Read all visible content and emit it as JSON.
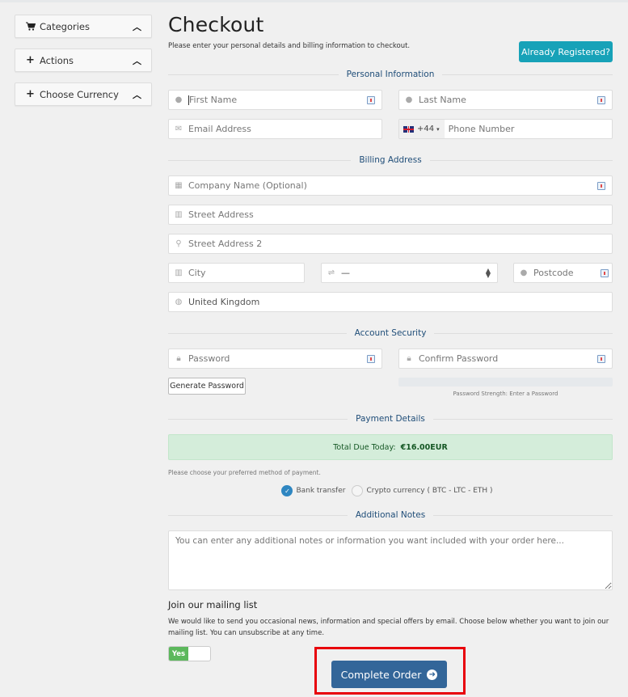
{
  "sidebar": {
    "panels": [
      {
        "label": "Categories",
        "icon": "shopping-cart-icon"
      },
      {
        "label": "Actions",
        "icon": "plus-icon"
      },
      {
        "label": "Choose Currency",
        "icon": "plus-icon"
      }
    ]
  },
  "header": {
    "title": "Checkout",
    "subtitle": "Please enter your personal details and billing information to checkout.",
    "already_registered": "Already Registered?"
  },
  "sections": {
    "personal": "Personal Information",
    "billing": "Billing Address",
    "security": "Account Security",
    "payment": "Payment Details",
    "notes": "Additional Notes"
  },
  "fields": {
    "first_name": "First Name",
    "last_name": "Last Name",
    "email": "Email Address",
    "phone_code": "+44",
    "phone": "Phone Number",
    "company": "Company Name (Optional)",
    "street": "Street Address",
    "street2": "Street Address 2",
    "city": "City",
    "state": "—",
    "postcode": "Postcode",
    "country": "United Kingdom",
    "password": "Password",
    "confirm_password": "Confirm Password"
  },
  "security": {
    "generate": "Generate Password",
    "strength_label": "Password Strength: Enter a Password"
  },
  "payment": {
    "total_label": "Total Due Today:",
    "total_value": "€16.00EUR",
    "method_note": "Please choose your preferred method of payment.",
    "methods": [
      {
        "label": "Bank transfer",
        "selected": true
      },
      {
        "label": "Crypto currency ( BTC - LTC - ETH )",
        "selected": false
      }
    ]
  },
  "notes": {
    "placeholder": "You can enter any additional notes or information you want included with your order here..."
  },
  "mailing": {
    "heading": "Join our mailing list",
    "text": "We would like to send you occasional news, information and special offers by email. Choose below whether you want to join our mailing list. You can unsubscribe at any time.",
    "toggle_label": "Yes"
  },
  "complete_order": "Complete Order",
  "colors": {
    "accent": "#17a2b8",
    "primary": "#336699",
    "success_bg": "#d4edda",
    "highlight": "#e8000b"
  }
}
